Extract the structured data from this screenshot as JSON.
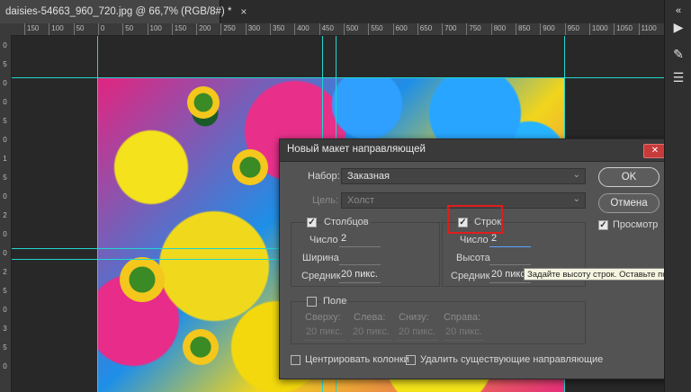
{
  "document": {
    "tab_title": "daisies-54663_960_720.jpg @ 66,7% (RGB/8#) *",
    "close": "×"
  },
  "ruler_top": {
    "labels": [
      "150",
      "100",
      "50",
      "0",
      "50",
      "100",
      "150",
      "200",
      "250",
      "300",
      "350",
      "400",
      "450",
      "500",
      "550",
      "600",
      "650",
      "700",
      "750",
      "800",
      "850",
      "900",
      "950",
      "1000",
      "1050",
      "1100"
    ]
  },
  "ruler_left": {
    "labels": [
      "0",
      "5",
      "0",
      "0",
      "5",
      "0",
      "1",
      "5",
      "0",
      "2",
      "0",
      "0",
      "2",
      "5",
      "0",
      "3",
      "5",
      "0"
    ]
  },
  "dialog": {
    "title": "Новый макет направляющей",
    "close": "✕",
    "preset_label": "Набор:",
    "preset_value": "Заказная",
    "target_label": "Цель:",
    "target_value": "Холст",
    "ok_label": "OK",
    "cancel_label": "Отмена",
    "preview_label": "Просмотр",
    "columns": {
      "title": "Столбцов",
      "count_label": "Число",
      "count_value": "2",
      "width_label": "Ширина",
      "width_value": "",
      "gutter_label": "Средник",
      "gutter_value": "20 пикс."
    },
    "rows": {
      "title": "Строк",
      "count_label": "Число",
      "count_value": "2",
      "height_label": "Высота",
      "height_value": "",
      "gutter_label": "Средник",
      "gutter_value": "20 пикс."
    },
    "margin": {
      "title": "Поле",
      "top_label": "Сверху:",
      "left_label": "Слева:",
      "bottom_label": "Снизу:",
      "right_label": "Справа:",
      "top_value": "20 пикс.",
      "left_value": "20 пикс.",
      "bottom_value": "20 пикс.",
      "right_value": "20 пикс."
    },
    "center_columns_label": "Центрировать колонки",
    "clear_guides_label": "Удалить существующие направляющие"
  },
  "tooltip": "Задайте высоту строк. Оставьте поле пустым",
  "checkmark": "✓",
  "arrow": "⌄",
  "icons": {
    "collapse": "«",
    "play": "▶",
    "brush": "✎",
    "sliders": "☰"
  },
  "colors": {
    "guide": "#22d6cf",
    "highlight": "#e01c1c"
  }
}
